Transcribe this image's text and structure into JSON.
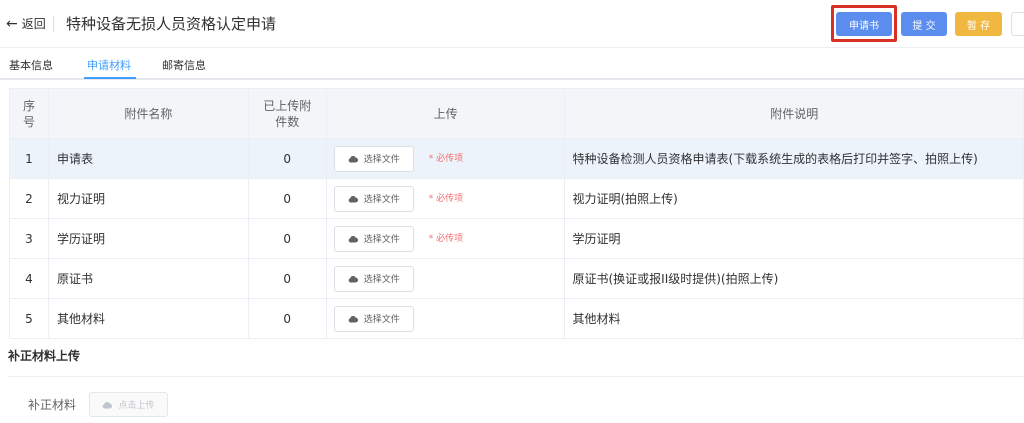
{
  "header": {
    "back_label": "返回",
    "title": "特种设备无损人员资格认定申请",
    "buttons": {
      "application": "申请书",
      "submit": "提 交",
      "save": "暂 存"
    }
  },
  "tabs": [
    {
      "label": "基本信息",
      "active": false
    },
    {
      "label": "申请材料",
      "active": true
    },
    {
      "label": "邮寄信息",
      "active": false
    }
  ],
  "table": {
    "headers": {
      "index": "序\n号",
      "name": "附件名称",
      "count": "已上传附\n件数",
      "upload": "上传",
      "desc": "附件说明"
    },
    "upload_button_label": "选择文件",
    "required_label": "* 必传项",
    "rows": [
      {
        "index": "1",
        "name": "申请表",
        "count": "0",
        "required": true,
        "desc": "特种设备检测人员资格申请表(下载系统生成的表格后打印并签字、拍照上传)"
      },
      {
        "index": "2",
        "name": "视力证明",
        "count": "0",
        "required": true,
        "desc": "视力证明(拍照上传)"
      },
      {
        "index": "3",
        "name": "学历证明",
        "count": "0",
        "required": true,
        "desc": "学历证明"
      },
      {
        "index": "4",
        "name": "原证书",
        "count": "0",
        "required": false,
        "desc": "原证书(换证或报II级时提供)(拍照上传)"
      },
      {
        "index": "5",
        "name": "其他材料",
        "count": "0",
        "required": false,
        "desc": "其他材料"
      }
    ]
  },
  "supplement": {
    "section_title": "补正材料上传",
    "label": "补正材料",
    "button_label": "点击上传"
  },
  "colors": {
    "primary": "#5b8def",
    "warning": "#f0b840",
    "highlight_border": "#d93025",
    "tab_active": "#409eff",
    "required": "#f56c6c"
  }
}
